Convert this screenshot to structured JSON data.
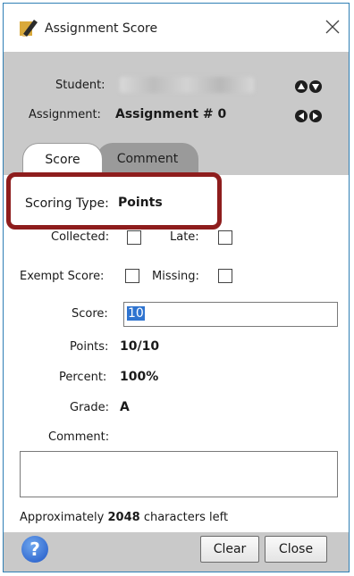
{
  "window": {
    "title": "Assignment Score"
  },
  "header": {
    "student_label": "Student:",
    "assignment_label": "Assignment:",
    "assignment_value": "Assignment # 0"
  },
  "tabs": [
    {
      "label": "Score"
    },
    {
      "label": "Comment"
    }
  ],
  "form": {
    "scoring_type_label": "Scoring Type:",
    "scoring_type_value": "Points",
    "collected_label": "Collected:",
    "late_label": "Late:",
    "exempt_label": "Exempt Score:",
    "missing_label": "Missing:",
    "score_label": "Score:",
    "score_value": "10",
    "points_label": "Points:",
    "points_value": "10/10",
    "percent_label": "Percent:",
    "percent_value": "100%",
    "grade_label": "Grade:",
    "grade_value": "A",
    "comment_label": "Comment:"
  },
  "chars_left": {
    "prefix": "Approximately",
    "count": "2048",
    "suffix": "characters left"
  },
  "footer": {
    "help_glyph": "?",
    "clear_label": "Clear",
    "close_label": "Close"
  },
  "colors": {
    "highlight": "#8e1d1d",
    "selection": "#2f74d0",
    "panel": "#c9c9c9"
  },
  "icons": [
    "pencil-app-icon",
    "close-icon",
    "up-arrow-icon",
    "down-arrow-icon",
    "left-arrow-icon",
    "right-arrow-icon",
    "help-icon"
  ]
}
